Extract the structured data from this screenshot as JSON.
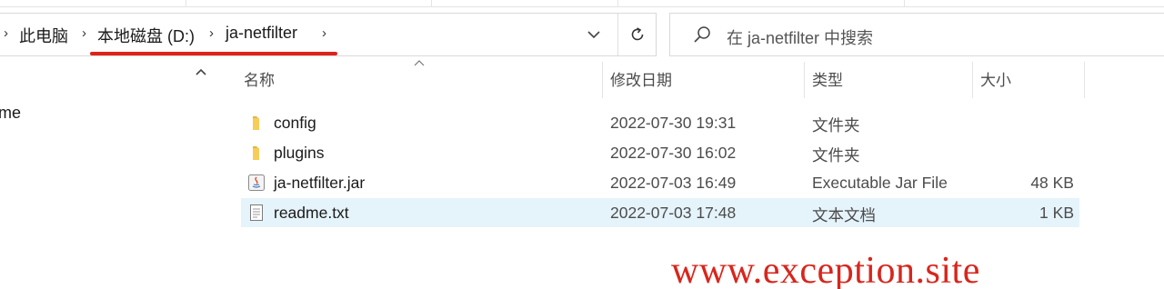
{
  "breadcrumb": {
    "items": [
      {
        "label": "此电脑"
      },
      {
        "label": "本地磁盘 (D:)"
      },
      {
        "label": "ja-netfilter"
      }
    ]
  },
  "search": {
    "placeholder": "在 ja-netfilter 中搜索"
  },
  "nav_pane": {
    "partial_item": "me"
  },
  "columns": {
    "name": "名称",
    "date": "修改日期",
    "type": "类型",
    "size": "大小"
  },
  "files": [
    {
      "name": "config",
      "date": "2022-07-30 19:31",
      "type": "文件夹",
      "size": "",
      "icon": "folder-icon"
    },
    {
      "name": "plugins",
      "date": "2022-07-30 16:02",
      "type": "文件夹",
      "size": "",
      "icon": "folder-icon"
    },
    {
      "name": "ja-netfilter.jar",
      "date": "2022-07-03 16:49",
      "type": "Executable Jar File",
      "size": "48 KB",
      "icon": "java-jar-icon"
    },
    {
      "name": "readme.txt",
      "date": "2022-07-03 17:48",
      "type": "文本文档",
      "size": "1 KB",
      "icon": "text-file-icon",
      "selected": true
    }
  ],
  "watermark": "www.exception.site",
  "colors": {
    "accent_red": "#e0221a",
    "selection": "#e5f3fb",
    "folder_yellow": "#f2c14e"
  }
}
